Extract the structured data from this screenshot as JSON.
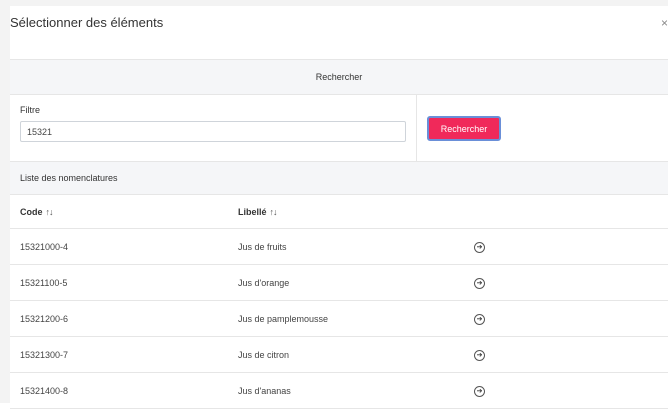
{
  "modal": {
    "title": "Sélectionner des éléments",
    "close_symbol": "×"
  },
  "search": {
    "section_title": "Rechercher",
    "filter_label": "Filtre",
    "filter_value": "15321",
    "button_label": "Rechercher",
    "button_color": "#f0295a"
  },
  "list": {
    "section_title": "Liste des nomenclatures",
    "columns": {
      "code": "Code",
      "label": "Libellé",
      "sort_icon_symbol": "↑↓"
    },
    "rows": [
      {
        "code": "15321000-4",
        "label": "Jus de fruits",
        "action_icon": "arrow-circle-right-icon"
      },
      {
        "code": "15321100-5",
        "label": "Jus d'orange",
        "action_icon": "arrow-circle-right-icon"
      },
      {
        "code": "15321200-6",
        "label": "Jus de pamplemousse",
        "action_icon": "arrow-circle-right-icon"
      },
      {
        "code": "15321300-7",
        "label": "Jus de citron",
        "action_icon": "arrow-circle-right-icon"
      },
      {
        "code": "15321400-8",
        "label": "Jus d'ananas",
        "action_icon": "arrow-circle-right-icon"
      }
    ]
  }
}
